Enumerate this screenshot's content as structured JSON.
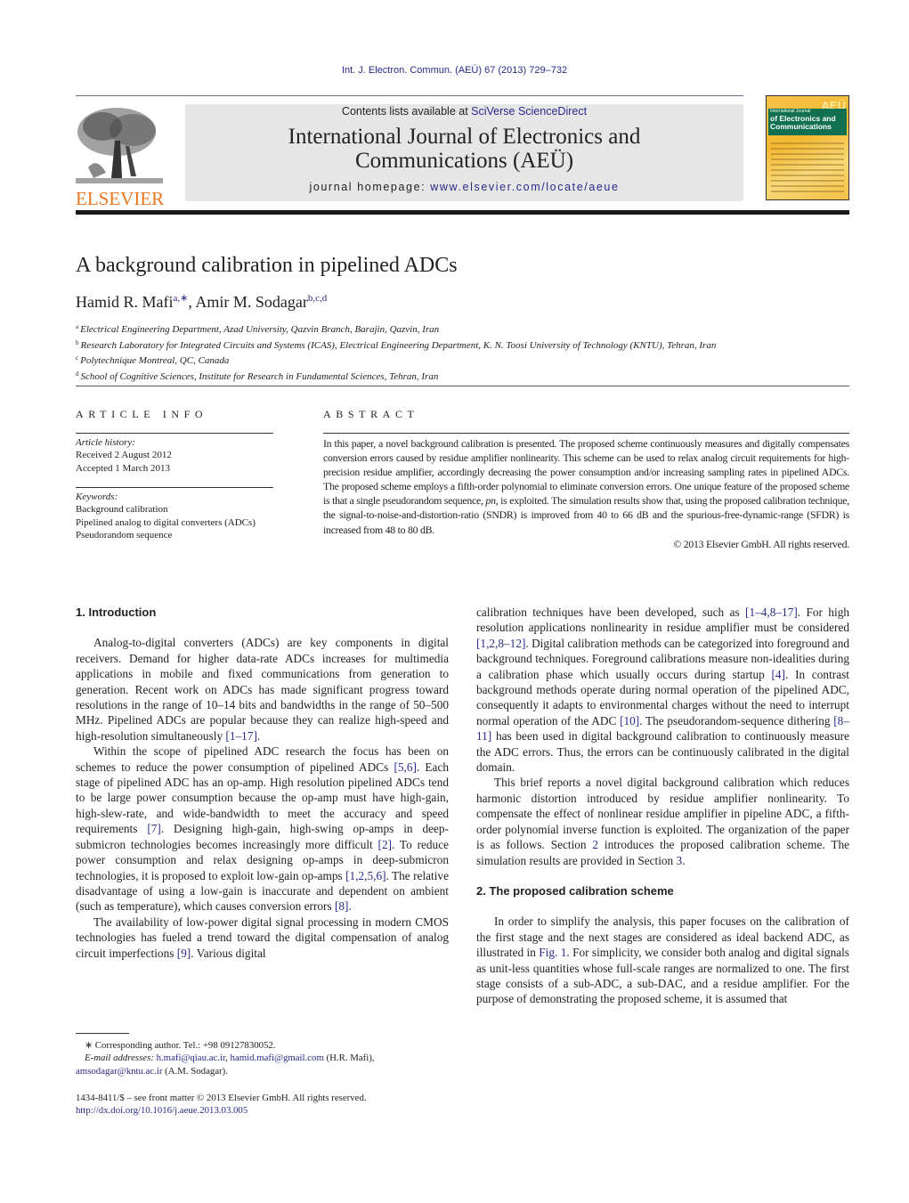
{
  "header": {
    "citation": "Int. J. Electron. Commun. (AEÜ) 67 (2013) 729–732",
    "contents_prefix": "Contents lists available at ",
    "contents_link": "SciVerse ScienceDirect",
    "journal_title_line1": "International Journal of Electronics and",
    "journal_title_line2": "Communications (AEÜ)",
    "homepage_prefix": "journal homepage: ",
    "homepage_link": "www.elsevier.com/locate/aeue",
    "publisher_logo_text": "ELSEVIER",
    "cover": {
      "badge": "AEÜ",
      "band_small": "International Journal",
      "band_big1": "of Electronics and",
      "band_big2": "Communications"
    }
  },
  "article": {
    "title": "A background calibration in pipelined ADCs",
    "authors": [
      {
        "name": "Hamid R. Mafi",
        "marks": "a,∗"
      },
      {
        "name": "Amir M. Sodagar",
        "marks": "b,c,d"
      }
    ],
    "author_separator": ", ",
    "affiliations": [
      {
        "mark": "a",
        "text": "Electrical Engineering Department, Azad University, Qazvin Branch, Barajin, Qazvin, Iran"
      },
      {
        "mark": "b",
        "text": "Research Laboratory for Integrated Circuits and Systems (ICAS), Electrical Engineering Department, K. N. Toosi University of Technology (KNTU), Tehran, Iran"
      },
      {
        "mark": "c",
        "text": "Polytechnique Montreal, QC, Canada"
      },
      {
        "mark": "d",
        "text": "School of Cognitive Sciences, Institute for Research in Fundamental Sciences, Tehran, Iran"
      }
    ]
  },
  "article_info": {
    "heading": "ARTICLE INFO",
    "history_label": "Article history:",
    "received": "Received 2 August 2012",
    "accepted": "Accepted 1 March 2013",
    "keywords_label": "Keywords:",
    "keywords": [
      "Background calibration",
      "Pipelined analog to digital converters (ADCs)",
      "Pseudorandom sequence"
    ]
  },
  "abstract": {
    "heading": "ABSTRACT",
    "text_before_pn": "In this paper, a novel background calibration is presented. The proposed scheme continuously measures and digitally compensates conversion errors caused by residue amplifier nonlinearity. This scheme can be used to relax analog circuit requirements for high-precision residue amplifier, accordingly decreasing the power consumption and/or increasing sampling rates in pipelined ADCs. The proposed scheme employs a fifth-order polynomial to eliminate conversion errors. One unique feature of the proposed scheme is that a single pseudorandom sequence, ",
    "pn": "pn",
    "text_after_pn": ", is exploited. The simulation results show that, using the proposed calibration technique, the signal-to-noise-and-distortion-ratio (SNDR) is improved from 40 to 66 dB and the spurious-free-dynamic-range (SFDR) is increased from 48 to 80 dB.",
    "copyright": "© 2013 Elsevier GmbH. All rights reserved."
  },
  "body": {
    "sec1_heading": "1.  Introduction",
    "p1": {
      "t1": "Analog-to-digital converters (ADCs) are key components in digital receivers. Demand for higher data-rate ADCs increases for multimedia applications in mobile and fixed communications from generation to generation. Recent work on ADCs has made significant progress toward resolutions in the range of 10–14 bits and bandwidths in the range of 50–500 MHz. Pipelined ADCs are popular because they can realize high-speed and high-resolution simultaneously ",
      "r1": "[1–17]",
      "t2": "."
    },
    "p2": {
      "t1": "Within the scope of pipelined ADC research the focus has been on schemes to reduce the power consumption of pipelined ADCs ",
      "r1": "[5,6]",
      "t2": ". Each stage of pipelined ADC has an op-amp. High resolution pipelined ADCs tend to be large power consumption because the op-amp must have high-gain, high-slew-rate, and wide-bandwidth to meet the accuracy and speed requirements ",
      "r2": "[7]",
      "t3": ". Designing high-gain, high-swing op-amps in deep-submicron technologies becomes increasingly more difficult ",
      "r3": "[2]",
      "t4": ". To reduce power consumption and relax designing op-amps in deep-submicron technologies, it is proposed to exploit low-gain op-amps ",
      "r4": "[1,2,5,6]",
      "t5": ". The relative disadvantage of using a low-gain is inaccurate and dependent on ambient (such as temperature), which causes conversion errors ",
      "r5": "[8]",
      "t6": "."
    },
    "p3": {
      "t1": "The availability of low-power digital signal processing in modern CMOS technologies has fueled a trend toward the digital compensation of analog circuit imperfections ",
      "r1": "[9]",
      "t2": ". Various digital"
    },
    "p3_cont": {
      "t1": "calibration techniques have been developed, such as ",
      "r1": "[1–4,8–17]",
      "t2": ". For high resolution applications nonlinearity in residue amplifier must be considered ",
      "r2": "[1,2,8–12]",
      "t3": ". Digital calibration methods can be categorized into foreground and background techniques. Foreground calibrations measure non-idealities during a calibration phase which usually occurs during startup ",
      "r3": "[4]",
      "t4": ". In contrast background methods operate during normal operation of the pipelined ADC, consequently it adapts to environmental charges without the need to interrupt normal operation of the ADC ",
      "r4": "[10]",
      "t5": ". The pseudorandom-sequence dithering ",
      "r5": "[8–11]",
      "t6": " has been used in digital background calibration to continuously measure the ADC errors. Thus, the errors can be continuously calibrated in the digital domain."
    },
    "p4": {
      "t1": "This brief reports a novel digital background calibration which reduces harmonic distortion introduced by residue amplifier nonlinearity. To compensate the effect of nonlinear residue amplifier in pipeline ADC, a fifth-order polynomial inverse function is exploited. The organization of the paper is as follows. Section ",
      "r1": "2",
      "t2": " introduces the proposed calibration scheme. The simulation results are provided in Section ",
      "r2": "3",
      "t3": "."
    },
    "sec2_heading": "2.  The proposed calibration scheme",
    "p5": {
      "t1": "In order to simplify the analysis, this paper focuses on the calibration of the first stage and the next stages are considered as ideal backend ADC, as illustrated in ",
      "r1": "Fig. 1",
      "t2": ". For simplicity, we consider both analog and digital signals as unit-less quantities whose full-scale ranges are normalized to one. The first stage consists of a sub-ADC, a sub-DAC, and a residue amplifier. For the purpose of demonstrating the proposed scheme, it is assumed that"
    }
  },
  "footnotes": {
    "corresponding": "∗ Corresponding author. Tel.: +98 09127830052.",
    "email_label": "E-mail addresses:",
    "email1": "h.mafi@qiau.ac.ir",
    "email_sep": ", ",
    "email2": "hamid.mafi@gmail.com",
    "email2_owner": " (H.R. Mafi),",
    "email3": "amsodagar@kntu.ac.ir",
    "email3_owner": " (A.M. Sodagar).",
    "front_matter": "1434-8411/$ – see front matter © 2013 Elsevier GmbH. All rights reserved.",
    "doi": "http://dx.doi.org/10.1016/j.aeue.2013.03.005"
  }
}
